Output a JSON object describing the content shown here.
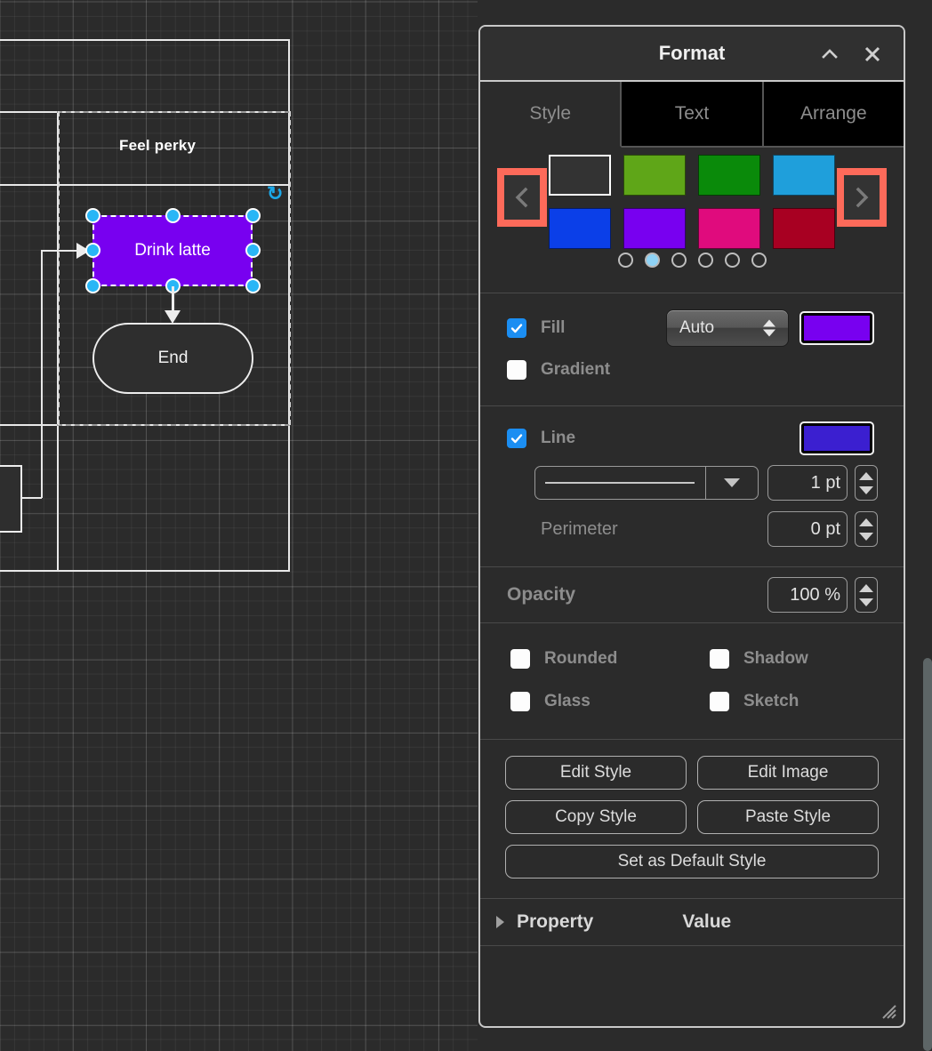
{
  "canvas": {
    "pool_label": "Feel perky",
    "shapes": [
      {
        "name": "Drink latte",
        "text": "Drink latte",
        "type": "process",
        "fill": "#7800f0",
        "selected": true
      },
      {
        "name": "End",
        "text": "End",
        "type": "terminator",
        "fill": "#2e2e2e",
        "selected": false
      }
    ]
  },
  "panel": {
    "title": "Format",
    "collapse_icon": "chevron-up-icon",
    "close_icon": "close-icon",
    "tabs": [
      {
        "label": "Style",
        "active": true
      },
      {
        "label": "Text",
        "active": false
      },
      {
        "label": "Arrange",
        "active": false
      }
    ],
    "swatches": {
      "prev_icon": "chevron-left-icon",
      "next_icon": "chevron-right-icon",
      "highlight_color": "#fd6a5a",
      "items": [
        {
          "name": "swatch-none",
          "color": "#333333",
          "outlined": true
        },
        {
          "name": "swatch-lime-green",
          "color": "#5fa618"
        },
        {
          "name": "swatch-green",
          "color": "#0a8a0a"
        },
        {
          "name": "swatch-sky-blue",
          "color": "#1f9fdb"
        },
        {
          "name": "swatch-blue",
          "color": "#0b3fe8"
        },
        {
          "name": "swatch-purple",
          "color": "#7800f0"
        },
        {
          "name": "swatch-magenta",
          "color": "#e00b7d"
        },
        {
          "name": "swatch-dark-red",
          "color": "#a80022"
        }
      ],
      "page_dots": 6,
      "active_dot": 2,
      "active_dot_color": "#8ed2f5"
    },
    "fill": {
      "label": "Fill",
      "checked": true,
      "mode": "Auto",
      "color": "#7800f0"
    },
    "gradient": {
      "label": "Gradient",
      "checked": false
    },
    "line": {
      "label": "Line",
      "checked": true,
      "color": "#3b1fd0",
      "style_preview": "solid-line",
      "width": "1 pt",
      "perimeter_label": "Perimeter",
      "perimeter": "0 pt"
    },
    "opacity": {
      "label": "Opacity",
      "value": "100 %"
    },
    "toggles": [
      {
        "label": "Rounded",
        "checked": false
      },
      {
        "label": "Shadow",
        "checked": false
      },
      {
        "label": "Glass",
        "checked": false
      },
      {
        "label": "Sketch",
        "checked": false
      }
    ],
    "buttons": [
      {
        "label": "Edit Style"
      },
      {
        "label": "Edit Image"
      },
      {
        "label": "Copy Style"
      },
      {
        "label": "Paste Style"
      },
      {
        "label": "Set as Default Style"
      }
    ],
    "property_table": {
      "disclosure_icon": "triangle-right-icon",
      "col_property": "Property",
      "col_value": "Value"
    },
    "resize_grip": "resize-grip-icon"
  }
}
